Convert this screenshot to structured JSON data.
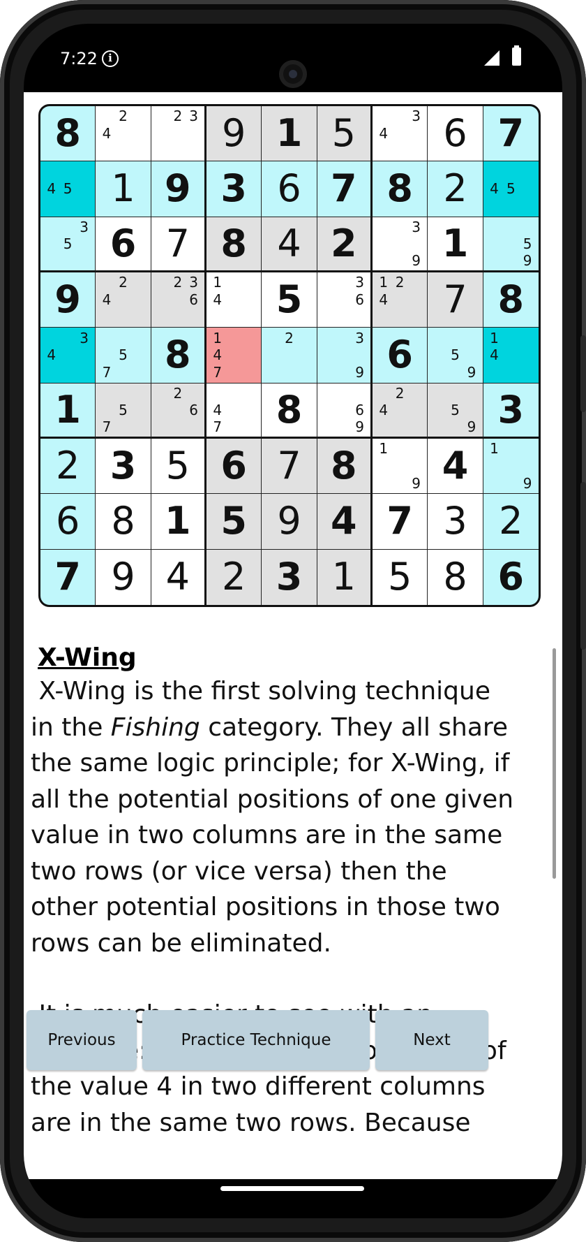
{
  "status_bar": {
    "time": "7:22",
    "icons": [
      "info-icon",
      "signal-icon",
      "battery-icon"
    ]
  },
  "colors": {
    "gray": "#e1e1e1",
    "cyan": "#c0f7fb",
    "teal": "#00d4de",
    "red": "#f59898"
  },
  "grid": {
    "rows": [
      [
        {
          "v": "8",
          "g": true,
          "bg": "cyan"
        },
        {
          "c": [
            "",
            "2",
            "",
            "4",
            "",
            "",
            "",
            "",
            ""
          ]
        },
        {
          "c": [
            "",
            "2",
            "3",
            "",
            "",
            "",
            "",
            "",
            ""
          ]
        },
        {
          "v": "9",
          "bg": "gray"
        },
        {
          "v": "1",
          "g": true,
          "bg": "gray"
        },
        {
          "v": "5",
          "bg": "gray"
        },
        {
          "c": [
            "",
            "",
            "3",
            "4",
            "",
            "",
            "",
            "",
            ""
          ]
        },
        {
          "v": "6"
        },
        {
          "v": "7",
          "g": true,
          "bg": "cyan"
        }
      ],
      [
        {
          "c": [
            "",
            "",
            "",
            "4",
            "5",
            "",
            "",
            "",
            ""
          ],
          "bg": "teal"
        },
        {
          "v": "1",
          "bg": "cyan"
        },
        {
          "v": "9",
          "g": true,
          "bg": "cyan"
        },
        {
          "v": "3",
          "g": true,
          "bg": "cyan"
        },
        {
          "v": "6",
          "bg": "cyan"
        },
        {
          "v": "7",
          "g": true,
          "bg": "cyan"
        },
        {
          "v": "8",
          "g": true,
          "bg": "cyan"
        },
        {
          "v": "2",
          "bg": "cyan"
        },
        {
          "c": [
            "",
            "",
            "",
            "4",
            "5",
            "",
            "",
            "",
            ""
          ],
          "bg": "teal"
        }
      ],
      [
        {
          "c": [
            "",
            "",
            "3",
            "",
            "5",
            "",
            "",
            "",
            ""
          ],
          "bg": "cyan"
        },
        {
          "v": "6",
          "g": true
        },
        {
          "v": "7"
        },
        {
          "v": "8",
          "g": true,
          "bg": "gray"
        },
        {
          "v": "4",
          "bg": "gray"
        },
        {
          "v": "2",
          "g": true,
          "bg": "gray"
        },
        {
          "c": [
            "",
            "",
            "3",
            "",
            "",
            "",
            "",
            "",
            "9"
          ]
        },
        {
          "v": "1",
          "g": true
        },
        {
          "c": [
            "",
            "",
            "",
            "",
            "",
            "5",
            "",
            "",
            "9"
          ],
          "bg": "cyan"
        }
      ],
      [
        {
          "v": "9",
          "g": true,
          "bg": "cyan"
        },
        {
          "c": [
            "",
            "2",
            "",
            "4",
            "",
            "",
            "",
            "",
            ""
          ],
          "bg": "gray"
        },
        {
          "c": [
            "",
            "2",
            "3",
            "",
            "",
            "6",
            "",
            "",
            ""
          ],
          "bg": "gray"
        },
        {
          "c": [
            "1",
            "",
            "",
            "4",
            "",
            "",
            "",
            "",
            ""
          ]
        },
        {
          "v": "5",
          "g": true
        },
        {
          "c": [
            "",
            "",
            "3",
            "",
            "",
            "6",
            "",
            "",
            ""
          ]
        },
        {
          "c": [
            "1",
            "2",
            "",
            "4",
            "",
            "",
            "",
            "",
            ""
          ],
          "bg": "gray"
        },
        {
          "v": "7",
          "bg": "gray"
        },
        {
          "v": "8",
          "g": true,
          "bg": "cyan"
        }
      ],
      [
        {
          "c": [
            "",
            "",
            "3",
            "4",
            "",
            "",
            "",
            "",
            ""
          ],
          "bg": "teal"
        },
        {
          "c": [
            "",
            "",
            "",
            "",
            "5",
            "",
            "7",
            "",
            ""
          ],
          "bg": "cyan"
        },
        {
          "v": "8",
          "g": true,
          "bg": "cyan"
        },
        {
          "c": [
            "1",
            "",
            "",
            "4",
            "",
            "",
            "7",
            "",
            ""
          ],
          "bg": "red"
        },
        {
          "c": [
            "",
            "2",
            "",
            "",
            "",
            "",
            "",
            "",
            ""
          ],
          "bg": "cyan"
        },
        {
          "c": [
            "",
            "",
            "3",
            "",
            "",
            "",
            "",
            "",
            "9"
          ],
          "bg": "cyan"
        },
        {
          "v": "6",
          "g": true,
          "bg": "cyan"
        },
        {
          "c": [
            "",
            "",
            "",
            "",
            "5",
            "",
            "",
            "",
            "9"
          ],
          "bg": "cyan"
        },
        {
          "c": [
            "1",
            "",
            "",
            "4",
            "",
            "",
            "",
            "",
            ""
          ],
          "bg": "teal"
        }
      ],
      [
        {
          "v": "1",
          "g": true,
          "bg": "cyan"
        },
        {
          "c": [
            "",
            "",
            "",
            "",
            "5",
            "",
            "7",
            "",
            ""
          ],
          "bg": "gray"
        },
        {
          "c": [
            "",
            "2",
            "",
            "",
            "",
            "6",
            "",
            "",
            ""
          ],
          "bg": "gray"
        },
        {
          "c": [
            "",
            "",
            "",
            "4",
            "",
            "",
            "7",
            "",
            ""
          ]
        },
        {
          "v": "8",
          "g": true
        },
        {
          "c": [
            "",
            "",
            "",
            "",
            "",
            "6",
            "",
            "",
            "9"
          ]
        },
        {
          "c": [
            "",
            "2",
            "",
            "4",
            "",
            "",
            "",
            "",
            ""
          ],
          "bg": "gray"
        },
        {
          "c": [
            "",
            "",
            "",
            "",
            "5",
            "",
            "",
            "",
            "9"
          ],
          "bg": "gray"
        },
        {
          "v": "3",
          "g": true,
          "bg": "cyan"
        }
      ],
      [
        {
          "v": "2",
          "bg": "cyan"
        },
        {
          "v": "3",
          "g": true
        },
        {
          "v": "5"
        },
        {
          "v": "6",
          "g": true,
          "bg": "gray"
        },
        {
          "v": "7",
          "bg": "gray"
        },
        {
          "v": "8",
          "g": true,
          "bg": "gray"
        },
        {
          "c": [
            "1",
            "",
            "",
            "",
            "",
            "",
            "",
            "",
            "9"
          ]
        },
        {
          "v": "4",
          "g": true
        },
        {
          "c": [
            "1",
            "",
            "",
            "",
            "",
            "",
            "",
            "",
            "9"
          ],
          "bg": "cyan"
        }
      ],
      [
        {
          "v": "6",
          "bg": "cyan"
        },
        {
          "v": "8"
        },
        {
          "v": "1",
          "g": true
        },
        {
          "v": "5",
          "g": true,
          "bg": "gray"
        },
        {
          "v": "9",
          "bg": "gray"
        },
        {
          "v": "4",
          "g": true,
          "bg": "gray"
        },
        {
          "v": "7",
          "g": true
        },
        {
          "v": "3"
        },
        {
          "v": "2",
          "bg": "cyan"
        }
      ],
      [
        {
          "v": "7",
          "g": true,
          "bg": "cyan"
        },
        {
          "v": "9"
        },
        {
          "v": "4"
        },
        {
          "v": "2",
          "bg": "gray"
        },
        {
          "v": "3",
          "g": true,
          "bg": "gray"
        },
        {
          "v": "1",
          "bg": "gray"
        },
        {
          "v": "5"
        },
        {
          "v": "8"
        },
        {
          "v": "6",
          "g": true,
          "bg": "cyan"
        }
      ]
    ]
  },
  "article": {
    "title": "X-Wing",
    "p1_lead": " X-Wing is the first solving technique in the ",
    "p1_em": "Fishing",
    "p1_rest": " category. They all share the same logic principle; for X-Wing, if all the potential positions of one given value in two columns are in the same two rows (or vice versa) then the other potential positions in those two rows can be eliminated.",
    "p2": " It is much easier to see with an example: all the potential positions of the value 4 in two different columns are in the same two rows. Because"
  },
  "buttons": {
    "previous": "Previous",
    "practice": "Practice Technique",
    "next": "Next"
  }
}
